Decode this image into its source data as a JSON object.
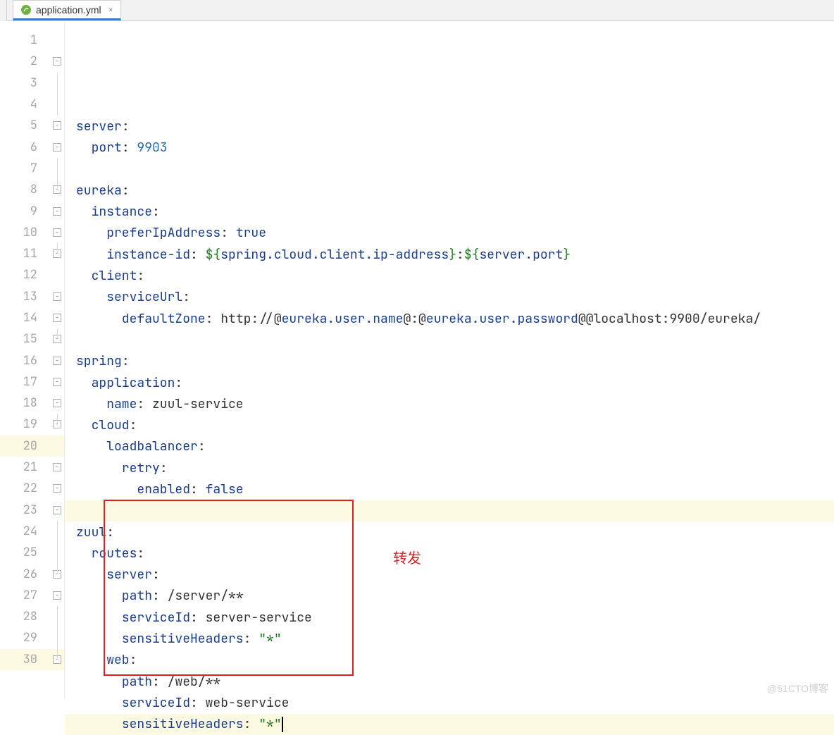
{
  "tab": {
    "filename": "application.yml",
    "close": "×"
  },
  "lines": [
    {
      "n": 1,
      "fold": "",
      "segs": []
    },
    {
      "n": 2,
      "fold": "open",
      "segs": [
        [
          "key",
          "server"
        ],
        [
          "val",
          ":"
        ]
      ]
    },
    {
      "n": 3,
      "fold": "line",
      "segs": [
        [
          "val",
          "  "
        ],
        [
          "key",
          "port"
        ],
        [
          "val",
          ": "
        ],
        [
          "num",
          "9903"
        ]
      ]
    },
    {
      "n": 4,
      "fold": "line",
      "segs": []
    },
    {
      "n": 5,
      "fold": "open",
      "segs": [
        [
          "key",
          "eureka"
        ],
        [
          "val",
          ":"
        ]
      ]
    },
    {
      "n": 6,
      "fold": "open",
      "segs": [
        [
          "val",
          "  "
        ],
        [
          "key",
          "instance"
        ],
        [
          "val",
          ":"
        ]
      ]
    },
    {
      "n": 7,
      "fold": "line",
      "segs": [
        [
          "val",
          "    "
        ],
        [
          "key",
          "preferIpAddress"
        ],
        [
          "val",
          ": "
        ],
        [
          "bool",
          "true"
        ]
      ]
    },
    {
      "n": 8,
      "fold": "close",
      "segs": [
        [
          "val",
          "    "
        ],
        [
          "key",
          "instance-id"
        ],
        [
          "val",
          ": "
        ],
        [
          "dollar",
          "${"
        ],
        [
          "ref",
          "spring.cloud.client.ip-address"
        ],
        [
          "dollar",
          "}"
        ],
        [
          "val",
          ":"
        ],
        [
          "dollar",
          "${"
        ],
        [
          "ref",
          "server.port"
        ],
        [
          "dollar",
          "}"
        ]
      ]
    },
    {
      "n": 9,
      "fold": "open",
      "segs": [
        [
          "val",
          "  "
        ],
        [
          "key",
          "client"
        ],
        [
          "val",
          ":"
        ]
      ]
    },
    {
      "n": 10,
      "fold": "open",
      "segs": [
        [
          "val",
          "    "
        ],
        [
          "key",
          "serviceUrl"
        ],
        [
          "val",
          ":"
        ]
      ]
    },
    {
      "n": 11,
      "fold": "close",
      "segs": [
        [
          "val",
          "      "
        ],
        [
          "key",
          "defaultZone"
        ],
        [
          "val",
          ": http://@"
        ],
        [
          "ref",
          "eureka.user.name"
        ],
        [
          "val",
          "@:@"
        ],
        [
          "ref",
          "eureka.user.password"
        ],
        [
          "val",
          "@@localhost:9900/eureka/"
        ]
      ]
    },
    {
      "n": 12,
      "fold": "",
      "segs": []
    },
    {
      "n": 13,
      "fold": "open",
      "segs": [
        [
          "key",
          "spring"
        ],
        [
          "val",
          ":"
        ]
      ]
    },
    {
      "n": 14,
      "fold": "open",
      "segs": [
        [
          "val",
          "  "
        ],
        [
          "key",
          "application"
        ],
        [
          "val",
          ":"
        ]
      ]
    },
    {
      "n": 15,
      "fold": "close",
      "segs": [
        [
          "val",
          "    "
        ],
        [
          "key",
          "name"
        ],
        [
          "val",
          ": zuul-service"
        ]
      ]
    },
    {
      "n": 16,
      "fold": "open",
      "segs": [
        [
          "val",
          "  "
        ],
        [
          "key",
          "cloud"
        ],
        [
          "val",
          ":"
        ]
      ]
    },
    {
      "n": 17,
      "fold": "open",
      "segs": [
        [
          "val",
          "    "
        ],
        [
          "key",
          "loadbalancer"
        ],
        [
          "val",
          ":"
        ]
      ]
    },
    {
      "n": 18,
      "fold": "open",
      "segs": [
        [
          "val",
          "      "
        ],
        [
          "key",
          "retry"
        ],
        [
          "val",
          ":"
        ]
      ]
    },
    {
      "n": 19,
      "fold": "close",
      "segs": [
        [
          "val",
          "        "
        ],
        [
          "key",
          "enabled"
        ],
        [
          "val",
          ": "
        ],
        [
          "bool",
          "false"
        ]
      ]
    },
    {
      "n": 20,
      "fold": "",
      "segs": [],
      "hl": true
    },
    {
      "n": 21,
      "fold": "open",
      "segs": [
        [
          "key",
          "zuul"
        ],
        [
          "val",
          ":"
        ]
      ]
    },
    {
      "n": 22,
      "fold": "open",
      "segs": [
        [
          "val",
          "  "
        ],
        [
          "key",
          "routes"
        ],
        [
          "val",
          ":"
        ]
      ]
    },
    {
      "n": 23,
      "fold": "open",
      "segs": [
        [
          "val",
          "    "
        ],
        [
          "key",
          "server"
        ],
        [
          "val",
          ":"
        ]
      ]
    },
    {
      "n": 24,
      "fold": "line",
      "segs": [
        [
          "val",
          "      "
        ],
        [
          "key",
          "path"
        ],
        [
          "val",
          ": /server/**"
        ]
      ]
    },
    {
      "n": 25,
      "fold": "line",
      "segs": [
        [
          "val",
          "      "
        ],
        [
          "key",
          "serviceId"
        ],
        [
          "val",
          ": server-service"
        ]
      ]
    },
    {
      "n": 26,
      "fold": "close",
      "segs": [
        [
          "val",
          "      "
        ],
        [
          "key",
          "sensitiveHeaders"
        ],
        [
          "val",
          ": "
        ],
        [
          "str",
          "\"*\""
        ]
      ]
    },
    {
      "n": 27,
      "fold": "open",
      "segs": [
        [
          "val",
          "    "
        ],
        [
          "key",
          "web"
        ],
        [
          "val",
          ":"
        ]
      ]
    },
    {
      "n": 28,
      "fold": "line",
      "segs": [
        [
          "val",
          "      "
        ],
        [
          "key",
          "path"
        ],
        [
          "val",
          ": /web/**"
        ]
      ]
    },
    {
      "n": 29,
      "fold": "line",
      "segs": [
        [
          "val",
          "      "
        ],
        [
          "key",
          "serviceId"
        ],
        [
          "val",
          ": web-service"
        ]
      ]
    },
    {
      "n": 30,
      "fold": "close",
      "segs": [
        [
          "val",
          "      "
        ],
        [
          "key",
          "sensitiveHeaders"
        ],
        [
          "val",
          ": "
        ],
        [
          "str",
          "\"*\""
        ]
      ],
      "cursor": true,
      "hl": true
    }
  ],
  "annotation": "转发",
  "watermark": "@51CTO博客"
}
